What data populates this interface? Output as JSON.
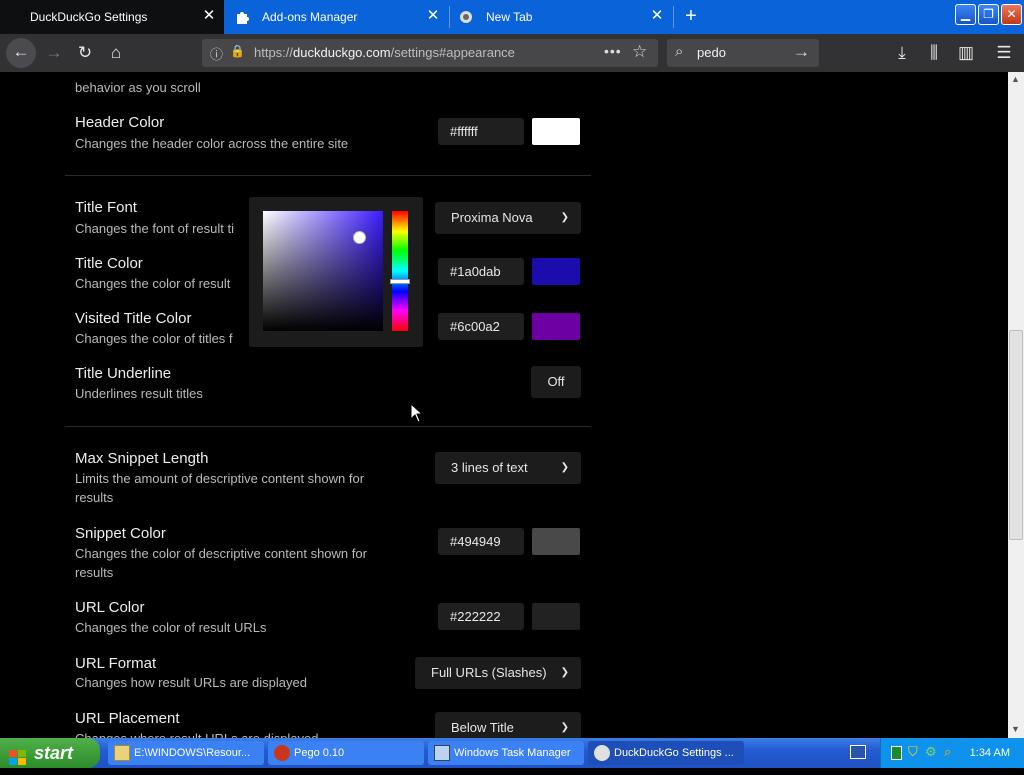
{
  "tabs": [
    {
      "label": "DuckDuckGo Settings",
      "active": true
    },
    {
      "label": "Add-ons Manager",
      "active": false
    },
    {
      "label": "New Tab",
      "active": false
    }
  ],
  "nav": {
    "url_prefix": "https://",
    "url_domain": "duckduckgo.com",
    "url_path": "/settings#appearance",
    "search_value": "pedo"
  },
  "settings": {
    "partial_desc": "behavior as you scroll",
    "header_color": {
      "title": "Header Color",
      "desc": "Changes the header color across the entire site",
      "value": "#ffffff",
      "swatch": "#ffffff"
    },
    "title_font": {
      "title": "Title Font",
      "desc": "Changes the font of result ti",
      "value": "Proxima Nova"
    },
    "title_color": {
      "title": "Title Color",
      "desc": "Changes the color of result",
      "value": "#1a0dab",
      "swatch": "#1a0dab"
    },
    "visited_title_color": {
      "title": "Visited Title Color",
      "desc": "Changes the color of titles f",
      "value": "#6c00a2",
      "swatch": "#6c00a2"
    },
    "title_underline": {
      "title": "Title Underline",
      "desc": "Underlines result titles",
      "value": "Off"
    },
    "max_snippet": {
      "title": "Max Snippet Length",
      "desc": "Limits the amount of descriptive content shown for results",
      "value": "3 lines of text"
    },
    "snippet_color": {
      "title": "Snippet Color",
      "desc": "Changes the color of descriptive content shown for results",
      "value": "#494949",
      "swatch": "#494949"
    },
    "url_color": {
      "title": "URL Color",
      "desc": "Changes the color of result URLs",
      "value": "#222222",
      "swatch": "#222222"
    },
    "url_format": {
      "title": "URL Format",
      "desc": "Changes how result URLs are displayed",
      "value": "Full URLs (Slashes)"
    },
    "url_placement": {
      "title": "URL Placement",
      "desc": "Changes where result URLs are displayed",
      "value": "Below Title"
    }
  },
  "taskbar": {
    "start_label": "start",
    "tasks": [
      {
        "label": "E:\\WINDOWS\\Resour...",
        "active": false
      },
      {
        "label": "Pego 0.10",
        "active": false
      },
      {
        "label": "Windows Task Manager",
        "active": false
      },
      {
        "label": "DuckDuckGo Settings ...",
        "active": true
      }
    ],
    "clock": "1:34 AM"
  }
}
